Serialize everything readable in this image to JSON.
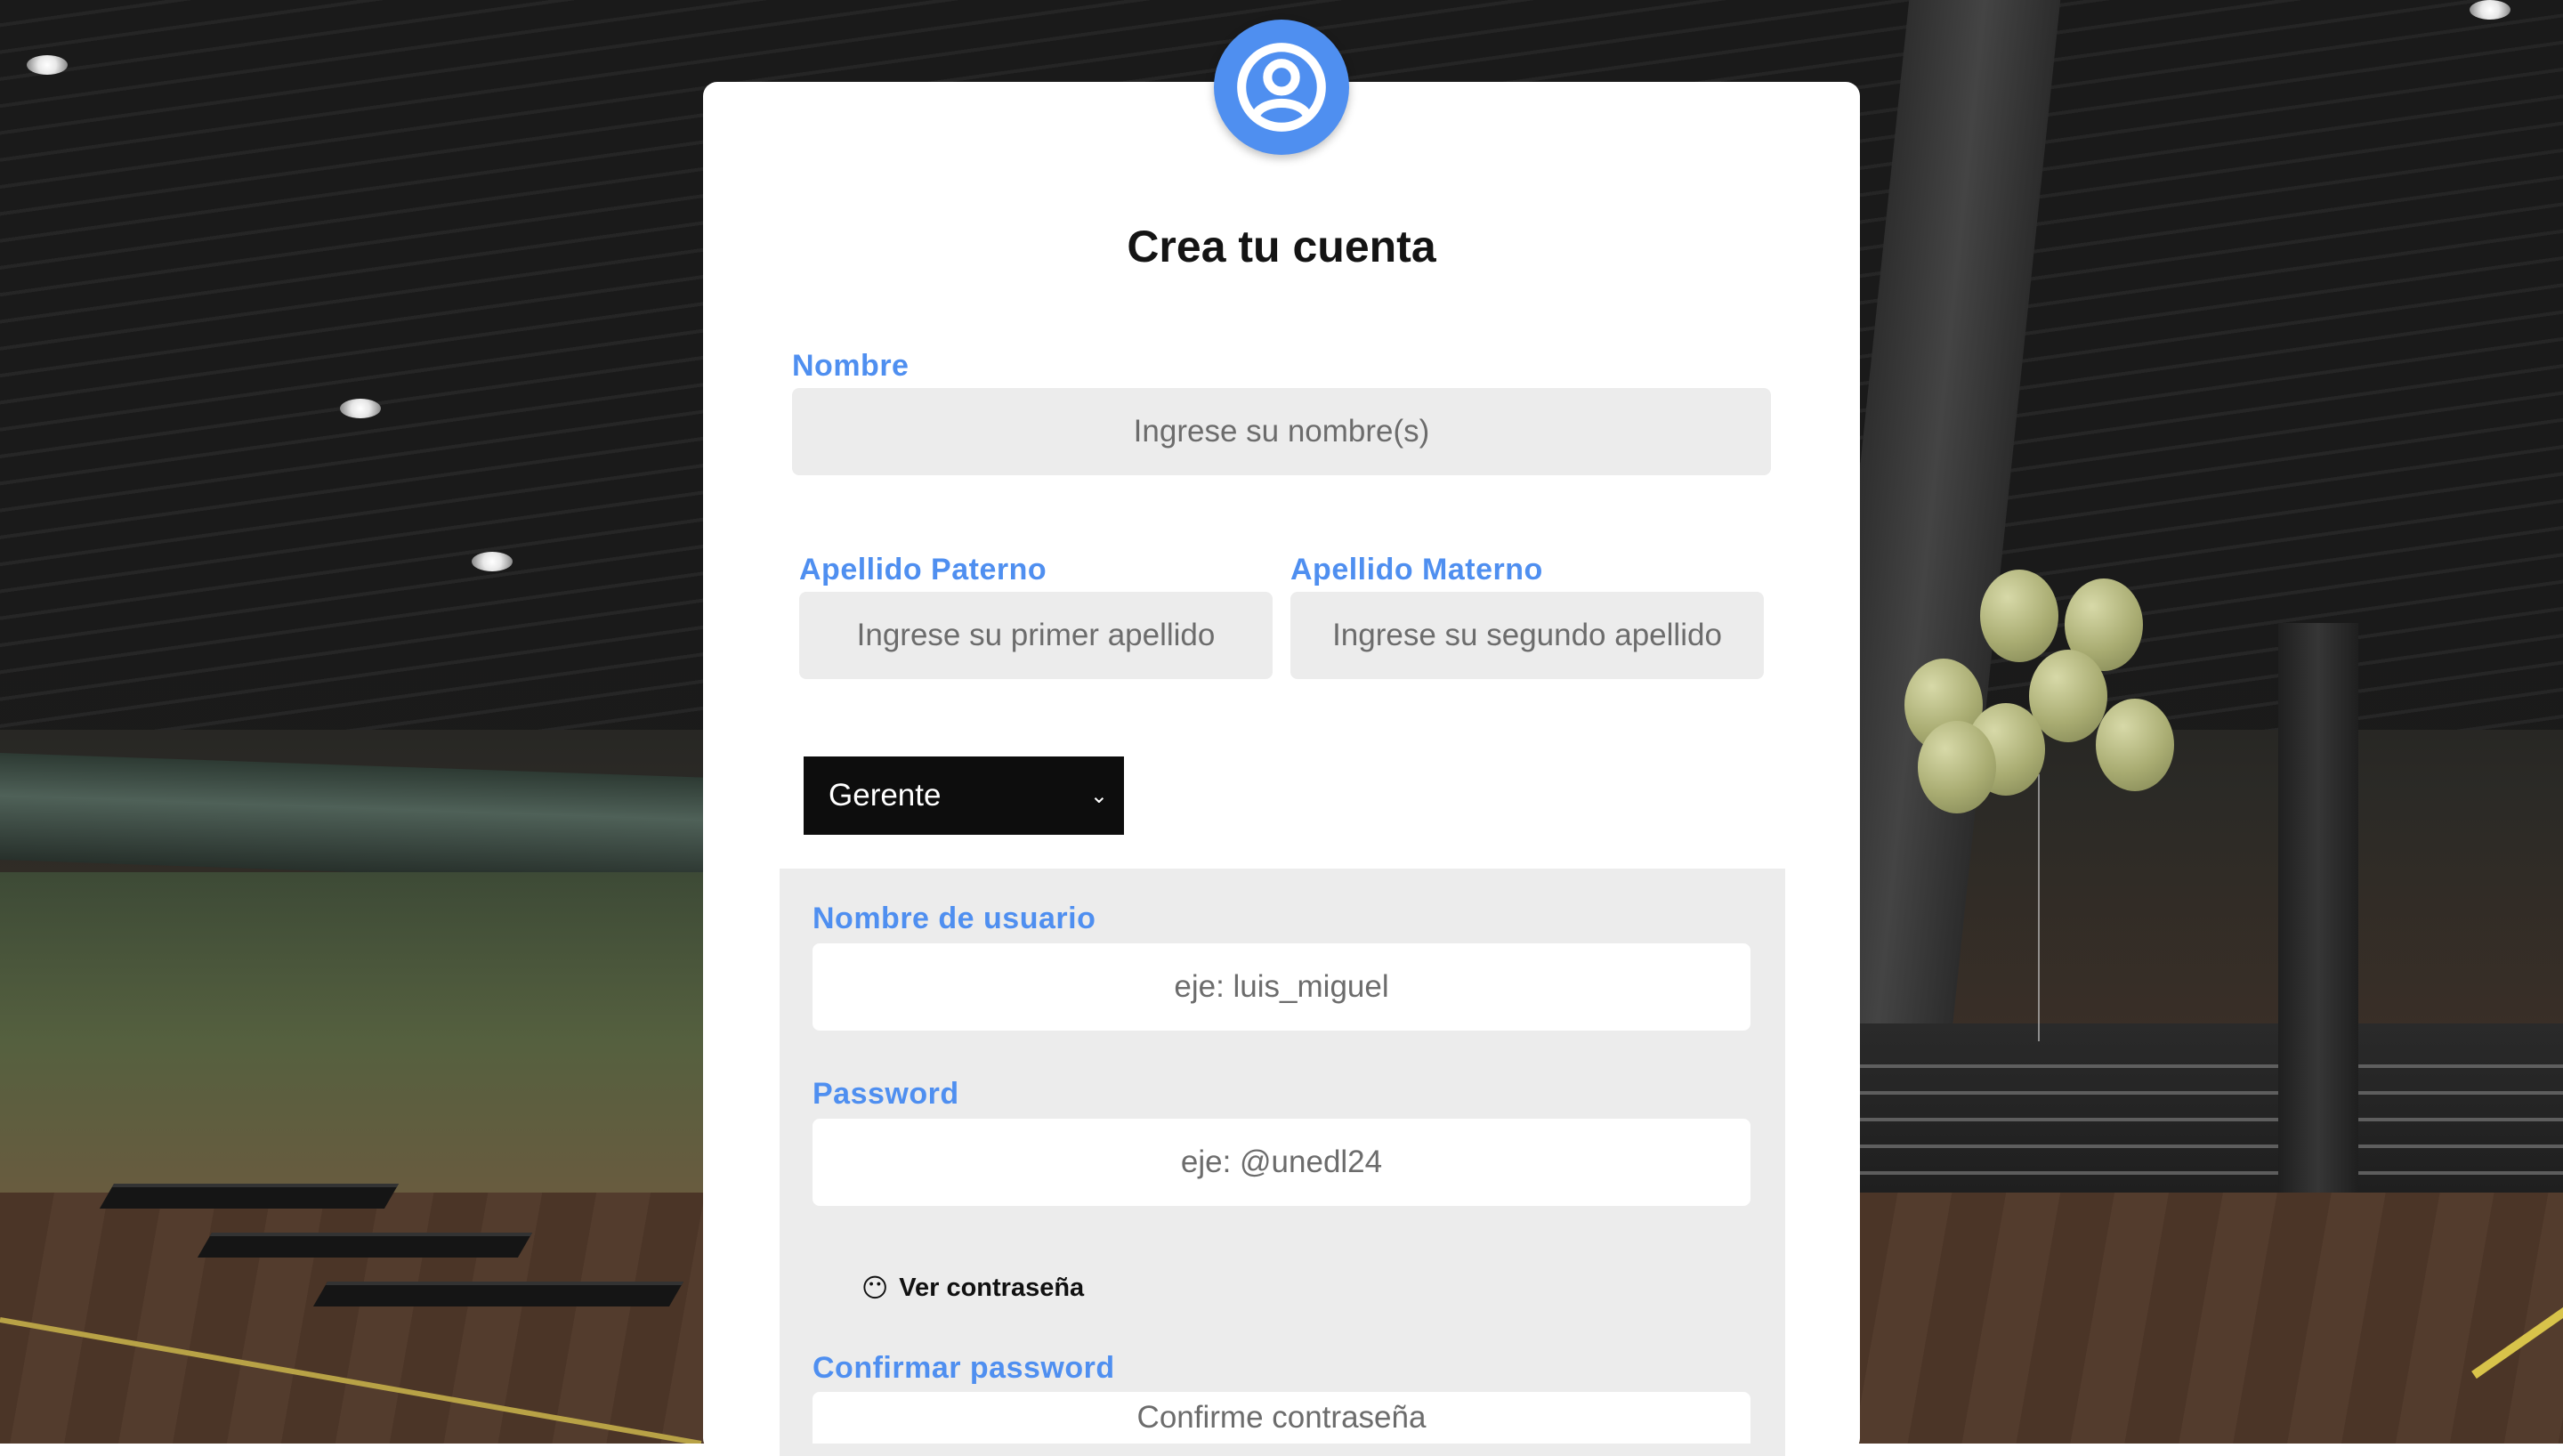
{
  "form": {
    "title": "Crea tu cuenta",
    "nombre": {
      "label": "Nombre",
      "placeholder": "Ingrese su nombre(s)"
    },
    "apellido_paterno": {
      "label": "Apellido Paterno",
      "placeholder": "Ingrese su primer apellido"
    },
    "apellido_materno": {
      "label": "Apellido Materno",
      "placeholder": "Ingrese su segundo apellido"
    },
    "role_select": {
      "selected": "Gerente"
    },
    "username": {
      "label": "Nombre de usuario",
      "placeholder": "eje: luis_miguel"
    },
    "password": {
      "label": "Password",
      "placeholder": "eje: @unedl24"
    },
    "show_password": {
      "icon": "😶",
      "label": "Ver contraseña"
    },
    "confirm_password": {
      "label": "Confirmar password",
      "placeholder": "Confirme contraseña"
    }
  },
  "colors": {
    "accent": "#4f8ff0",
    "card": "#ffffff",
    "input_bg": "#ececec",
    "select_bg": "#0d0d0d"
  },
  "icons": {
    "avatar": "user-circle-icon"
  }
}
